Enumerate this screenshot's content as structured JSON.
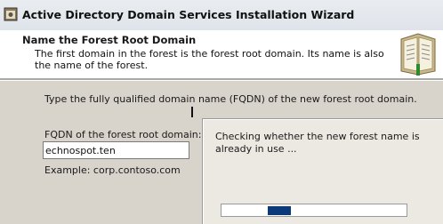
{
  "window": {
    "title": "Active Directory Domain Services Installation Wizard",
    "icon": "wizard-window-icon"
  },
  "header": {
    "title": "Name the Forest Root Domain",
    "description": "The first domain in the forest is the forest root domain. Its name is also the name of the forest.",
    "icon": "books-icon"
  },
  "main": {
    "instruction": "Type the fully qualified domain name (FQDN) of the new forest root domain.",
    "fqdn_label": "FQDN of the forest root domain:",
    "fqdn_value": "echnospot.ten",
    "example": "Example: corp.contoso.com"
  },
  "progress_dialog": {
    "message": "Checking whether the new forest name is already in use ...",
    "progress_fraction": 0.4
  }
}
